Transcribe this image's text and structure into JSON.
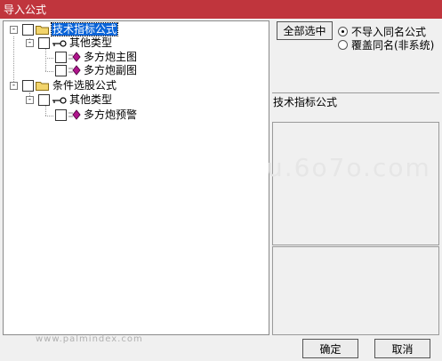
{
  "window": {
    "title": "导入公式"
  },
  "tree": {
    "nodes": [
      {
        "label": "技术指标公式",
        "selected": true
      },
      {
        "label": "其他类型"
      },
      {
        "label": "多方炮主图"
      },
      {
        "label": "多方炮副图"
      },
      {
        "label": "条件选股公式"
      },
      {
        "label": "其他类型"
      },
      {
        "label": "多方炮预警"
      }
    ],
    "expander_symbol": "-"
  },
  "options": {
    "select_all_label": "全部选中",
    "radio_no_import": "不导入同名公式",
    "radio_overwrite": "覆盖同名(非系统)",
    "selected_radio": "no_import"
  },
  "info": {
    "header": "技术指标公式"
  },
  "footer": {
    "ok_label": "确定",
    "cancel_label": "取消"
  },
  "watermark": {
    "text": "u.6o7o.com",
    "footer": "www.palmindex.com"
  },
  "colors": {
    "titlebar": "#c0353d",
    "selection": "#0a64d8",
    "folder": "#f2d46b",
    "diamond": "#b0148c"
  }
}
